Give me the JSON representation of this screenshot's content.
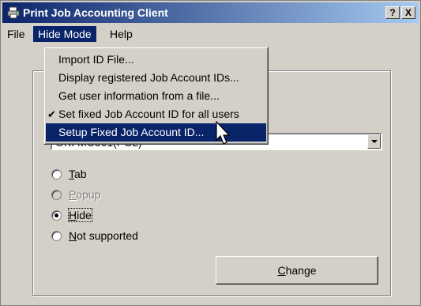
{
  "window": {
    "title": "Print Job Accounting Client",
    "help_btn": "?",
    "close_btn": "X"
  },
  "menubar": [
    {
      "label": "File"
    },
    {
      "label": "Hide Mode"
    },
    {
      "label": "Help"
    }
  ],
  "dropdown": {
    "items": [
      {
        "label": "Import ID File...",
        "checked": false,
        "highlighted": false
      },
      {
        "label": "Display registered Job Account IDs...",
        "checked": false,
        "highlighted": false
      },
      {
        "label": "Get user information from a file...",
        "checked": false,
        "highlighted": false
      },
      {
        "label": "Set fixed Job Account ID for all users",
        "checked": true,
        "highlighted": false
      },
      {
        "label": "Setup Fixed Job Account ID...",
        "checked": false,
        "highlighted": true
      }
    ],
    "check_glyph": "✔"
  },
  "printer_select": {
    "value": "OKI MC361(PCL)"
  },
  "radios": [
    {
      "label_ul": "T",
      "label_rest": "ab",
      "checked": false,
      "disabled": false
    },
    {
      "label_ul": "P",
      "label_rest": "opup",
      "checked": false,
      "disabled": true
    },
    {
      "label_ul": "H",
      "label_rest": "ide",
      "checked": true,
      "disabled": false
    },
    {
      "label_ul": "N",
      "label_rest": "ot supported",
      "checked": false,
      "disabled": false
    }
  ],
  "change_button": {
    "label_ul": "C",
    "label_rest": "hange"
  },
  "icons": {
    "title": "printer-icon",
    "cursor": "arrow-cursor-icon"
  }
}
